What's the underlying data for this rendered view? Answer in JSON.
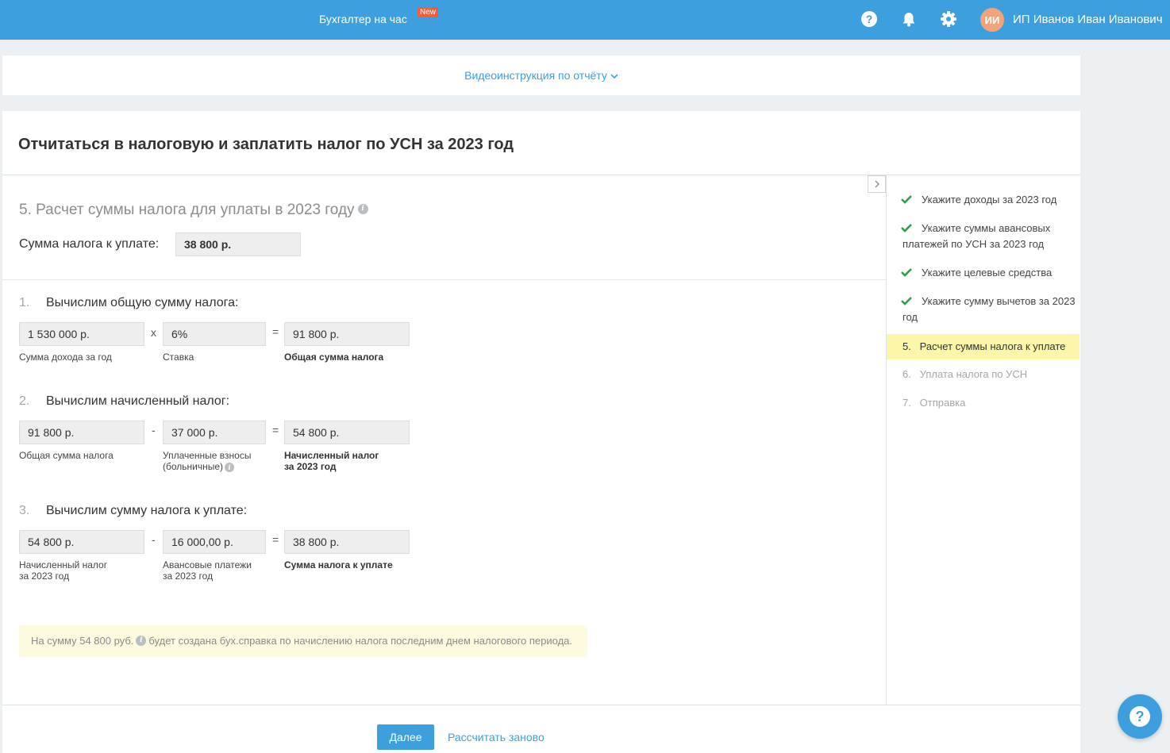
{
  "topbar": {
    "promo_label": "Бухгалтер на час",
    "promo_badge": "New",
    "avatar_initials": "ИИ",
    "user_name": "ИП Иванов Иван Иванович",
    "bg_color": "#3d9fde"
  },
  "video": {
    "link_label": "Видеоинструкция по отчёту"
  },
  "page": {
    "title": "Отчитаться в налоговую и заплатить налог по УСН за 2023 год"
  },
  "section": {
    "title": "5. Расчет суммы налога для уплаты в 2023 году",
    "tax_label": "Сумма налога к уплате:",
    "tax_value": "38 800 р."
  },
  "steps": [
    {
      "num": "1.",
      "title": "Вычислим общую сумму налога:",
      "op": "x",
      "eq": "=",
      "a_value": "1 530 000 р.",
      "a_caption": "Сумма дохода за год",
      "b_value": "6%",
      "b_caption": "Ставка",
      "r_value": "91 800 р.",
      "r_caption": "Общая сумма налога"
    },
    {
      "num": "2.",
      "title": "Вычислим начисленный налог:",
      "op": "-",
      "eq": "=",
      "a_value": "91 800 р.",
      "a_caption": "Общая сумма налога",
      "b_value": "37 000 р.",
      "b_caption_1": "Уплаченные взносы",
      "b_caption_2": "(больничные)",
      "r_value": "54 800 р.",
      "r_caption_1": "Начисленный налог",
      "r_caption_2": "за 2023 год"
    },
    {
      "num": "3.",
      "title": "Вычислим сумму налога к уплате:",
      "op": "-",
      "eq": "=",
      "a_value": "54 800 р.",
      "a_caption_1": "Начисленный налог",
      "a_caption_2": "за 2023 год",
      "b_value": "16 000,00 р.",
      "b_caption_1": "Авансовые платежи",
      "b_caption_2": "за 2023 год",
      "r_value": "38 800 р.",
      "r_caption": "Сумма налога к уплате"
    }
  ],
  "note": {
    "part1": "На сумму 54 800 руб.",
    "part2": "будет создана бух.справка по начислению налога последним днем налогового периода."
  },
  "actions": {
    "next_label": "Далее",
    "recalc_label": "Рассчитать заново"
  },
  "sidebar": {
    "items": [
      {
        "label": "Укажите доходы за 2023 год",
        "status": "done"
      },
      {
        "label": "Укажите суммы авансовых платежей по УСН за 2023 год",
        "status": "done"
      },
      {
        "label": "Укажите целевые средства",
        "status": "done"
      },
      {
        "label": "Укажите сумму вычетов за 2023 год",
        "status": "done"
      },
      {
        "label": "5.   Расчет суммы налога к уплате",
        "status": "active"
      },
      {
        "label": "6.   Уплата налога по УСН",
        "status": "pending"
      },
      {
        "label": "7.   Отправка",
        "status": "pending"
      }
    ],
    "check_color": "#2e9e4f",
    "active_bg": "#fbf6a8"
  },
  "icons": {
    "help": "help-icon",
    "bell": "bell-icon",
    "gear": "gear-icon",
    "chevron": "chevron-down-icon",
    "collapse": "chevron-right-icon",
    "info": "info-icon",
    "check": "check-icon",
    "fab": "help-icon"
  }
}
